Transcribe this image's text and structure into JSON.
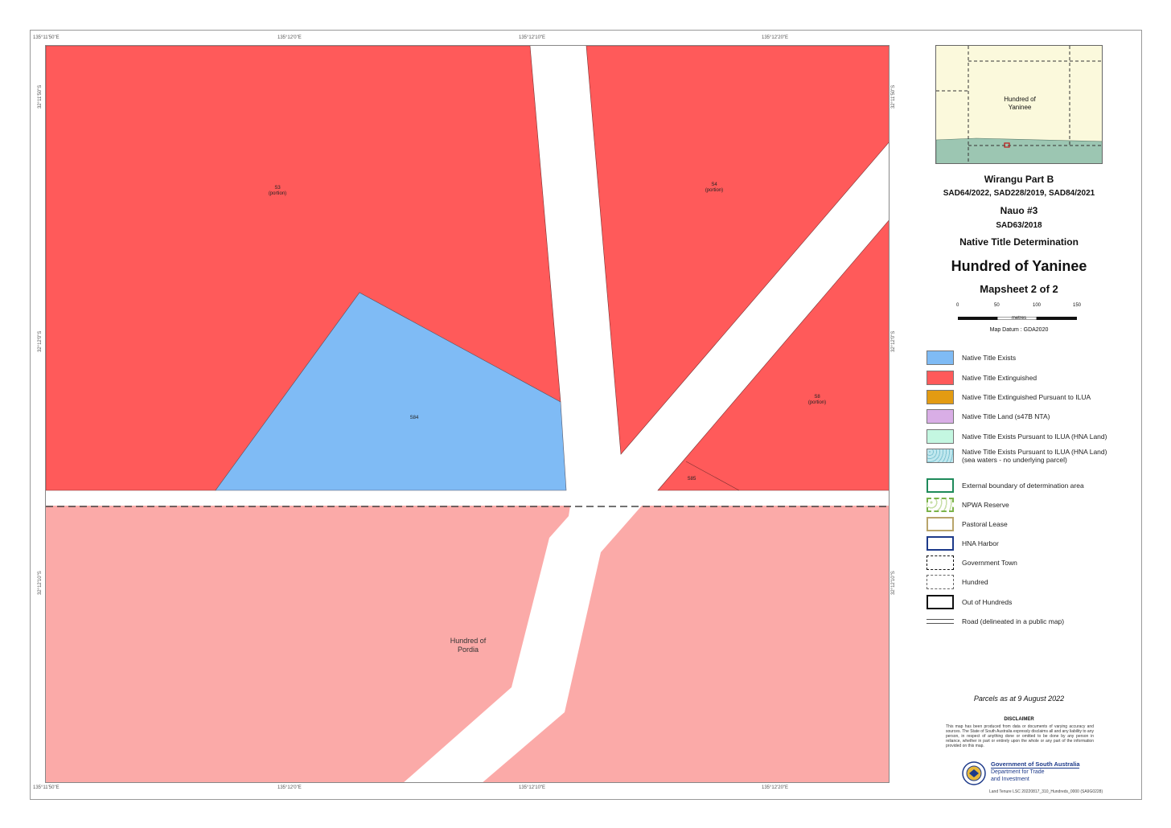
{
  "map": {
    "top_coords": [
      "135°11'50\"E",
      "135°12'0\"E",
      "135°12'10\"E",
      "135°12'20\"E"
    ],
    "bottom_coords": [
      "135°11'50\"E",
      "135°12'0\"E",
      "135°12'10\"E",
      "135°12'20\"E"
    ],
    "left_coords": [
      "32°11'50\"S",
      "32°12'0\"S",
      "32°12'10\"S"
    ],
    "right_coords": [
      "32°11'50\"S",
      "32°12'0\"S",
      "32°12'10\"S"
    ],
    "parcel_labels": [
      {
        "id": "S3",
        "sub": "(portion)"
      },
      {
        "id": "S4",
        "sub": "(portion)"
      },
      {
        "id": "S8",
        "sub": "(portion)"
      },
      {
        "id": "S84",
        "sub": ""
      },
      {
        "id": "S85",
        "sub": ""
      }
    ],
    "hundred_label_line1": "Hundred of",
    "hundred_label_line2": "Pordia",
    "colors": {
      "extinguished": "#ff5a5a",
      "exists": "#7fbbf5",
      "out_area": "#fbaaa8",
      "road": "#ffffff"
    }
  },
  "inset": {
    "label_line1": "Hundred of",
    "label_line2": "Yaninee"
  },
  "titles": {
    "claim1": "Wirangu Part B",
    "claim1_numbers": "SAD64/2022, SAD228/2019, SAD84/2021",
    "claim2": "Nauo #3",
    "claim2_numbers": "SAD63/2018",
    "determination": "Native Title Determination",
    "hundred": "Hundred of Yaninee",
    "mapsheet": "Mapsheet 2 of 2"
  },
  "scale": {
    "ticks": [
      "0",
      "50",
      "100",
      "150"
    ],
    "unit": "metres",
    "datum": "Map Datum : GDA2020"
  },
  "legend": [
    {
      "label": "Native Title Exists",
      "kind": "fill",
      "color": "#7fbbf5"
    },
    {
      "label": "Native Title Extinguished",
      "kind": "fill",
      "color": "#ff5a5a"
    },
    {
      "label": "Native Title Extinguished Pursuant to ILUA",
      "kind": "fill",
      "color": "#e39b12"
    },
    {
      "label": "Native Title Land (s47B NTA)",
      "kind": "fill",
      "color": "#d9aee6"
    },
    {
      "label": "Native Title Exists Pursuant to ILUA (HNA Land)",
      "kind": "fill",
      "color": "#c4f7e1"
    },
    {
      "label": "Native Title Exists Pursuant to ILUA (HNA Land)",
      "label2": "(sea waters - no underlying parcel)",
      "kind": "pattern",
      "color": "#bfe7ee"
    },
    {
      "label": "External boundary of determination area",
      "kind": "outline",
      "color": "#1e8a5a"
    },
    {
      "label": "NPWA Reserve",
      "kind": "dotted",
      "color": "#7bb34a"
    },
    {
      "label": "Pastoral Lease",
      "kind": "outline",
      "color": "#b8a46a"
    },
    {
      "label": "HNA Harbor",
      "kind": "outline",
      "color": "#1d3a8a"
    },
    {
      "label": "Government Town",
      "kind": "dashed",
      "color": "#111111"
    },
    {
      "label": "Hundred",
      "kind": "dashed",
      "color": "#666666"
    },
    {
      "label": "Out of Hundreds",
      "kind": "outline",
      "color": "#111111"
    },
    {
      "label": "Road (delineated in a public map)",
      "kind": "road",
      "color": "#555555"
    }
  ],
  "footer": {
    "parcels_date": "Parcels as at 9 August 2022",
    "disclaimer_title": "DISCLAIMER",
    "disclaimer_text": "This map has been produced from data or documents of varying accuracy and sources. The State of South Australia expressly disclaims all and any liability to any person, in respect of anything done or omitted to be done by any person in reliance, whether in part or entirely upon the whole or any part of the information provided on this map.",
    "gov_line1": "Government of South Australia",
    "gov_line2": "Department for Trade",
    "gov_line3": "and Investment",
    "reference": "Land Tenure LSC 20220817_310_Hundreds_0000 (SA9G0228)"
  }
}
